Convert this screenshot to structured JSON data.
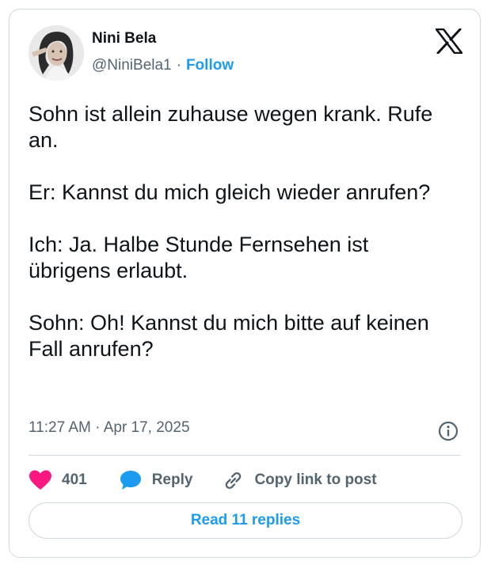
{
  "author": {
    "name": "Nini Bela",
    "handle": "@NiniBela1",
    "separator": "·",
    "follow_label": "Follow",
    "avatar_icon": "profile-photo"
  },
  "brand": {
    "logo_icon": "x-logo",
    "color": "#0f1419"
  },
  "tweet": {
    "paragraphs": [
      "Sohn ist allein zuhause wegen krank. Rufe an.",
      "Er: Kannst du mich gleich wieder anrufen?",
      "Ich: Ja. Halbe Stunde Fernsehen ist übrigens erlaubt.",
      "Sohn: Oh! Kannst du mich bitte auf keinen Fall anrufen?"
    ],
    "timestamp": "11:27 AM · Apr 17, 2025"
  },
  "actions": {
    "likes_count": "401",
    "reply_label": "Reply",
    "copy_label": "Copy link to post",
    "like_icon": "heart-icon",
    "reply_icon": "speech-bubble-icon",
    "copy_icon": "link-icon"
  },
  "footer": {
    "read_replies_label": "Read 11 replies"
  },
  "colors": {
    "accent": "#1d9bf0",
    "like": "#f91880",
    "muted_text": "#536471",
    "border": "#cfd9de"
  }
}
